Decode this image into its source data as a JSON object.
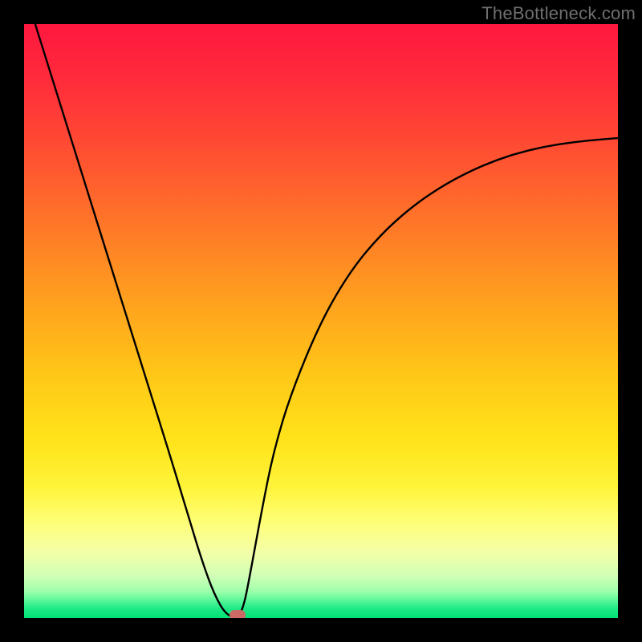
{
  "watermark": "TheBottleneck.com",
  "colors": {
    "black": "#000000",
    "marker": "#cc6a66",
    "curve": "#000000"
  },
  "chart_data": {
    "type": "line",
    "title": "",
    "xlabel": "",
    "ylabel": "",
    "xlim": [
      0,
      100
    ],
    "ylim": [
      0,
      100
    ],
    "gradient_stops": [
      {
        "pos": 0.0,
        "color": "#ff173f"
      },
      {
        "pos": 0.1,
        "color": "#ff2d3b"
      },
      {
        "pos": 0.2,
        "color": "#ff4a33"
      },
      {
        "pos": 0.3,
        "color": "#ff6a2b"
      },
      {
        "pos": 0.4,
        "color": "#ff8b24"
      },
      {
        "pos": 0.5,
        "color": "#ffab1c"
      },
      {
        "pos": 0.6,
        "color": "#ffca17"
      },
      {
        "pos": 0.7,
        "color": "#ffe31a"
      },
      {
        "pos": 0.78,
        "color": "#fff43a"
      },
      {
        "pos": 0.84,
        "color": "#feff78"
      },
      {
        "pos": 0.89,
        "color": "#f3ffa8"
      },
      {
        "pos": 0.93,
        "color": "#d0ffb6"
      },
      {
        "pos": 0.955,
        "color": "#9effab"
      },
      {
        "pos": 0.97,
        "color": "#5cf79a"
      },
      {
        "pos": 0.985,
        "color": "#1de985"
      },
      {
        "pos": 1.0,
        "color": "#00e175"
      }
    ],
    "series": [
      {
        "name": "bottleneck-curve",
        "x": [
          0,
          5,
          10,
          15,
          20,
          25,
          28,
          30,
          32,
          34,
          36,
          37,
          38,
          40,
          42,
          45,
          50,
          55,
          60,
          65,
          70,
          75,
          80,
          85,
          90,
          95,
          100
        ],
        "values": [
          106,
          90,
          74,
          58,
          42,
          26,
          16,
          9.5,
          4,
          0.5,
          0,
          2,
          7,
          18,
          28,
          38,
          50,
          58.5,
          64.5,
          69,
          72.5,
          75.2,
          77.3,
          78.8,
          79.8,
          80.4,
          80.8
        ]
      }
    ],
    "minimum_marker": {
      "x": 36,
      "y": 0
    }
  }
}
